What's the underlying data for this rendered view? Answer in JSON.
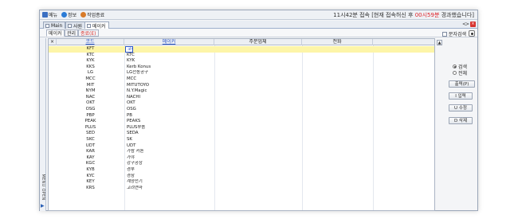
{
  "toolbar": {
    "menu_label": "메뉴",
    "info_label": "정보",
    "end_label": "작업종료",
    "status_prefix": "11시42분 접속 [현재 접속허신 후 ",
    "status_elapsed": "00시59분",
    "status_suffix": " 경과했습니다]"
  },
  "tabs": [
    {
      "label": "Main"
    },
    {
      "label": "사원"
    },
    {
      "label": "메이커"
    }
  ],
  "nav": {
    "prev": "<",
    "next": ">",
    "close": "×"
  },
  "subtabs": [
    {
      "label": "메이커"
    },
    {
      "label": "관리"
    },
    {
      "label": "종료(E)"
    }
  ],
  "search_toggle": "문자검색",
  "grid": {
    "headers": {
      "mark": "×",
      "code": "코드",
      "maker": "메이커",
      "client": "주문업체",
      "phone": "전화"
    },
    "rows": [
      {
        "code": "KFT",
        "name": "코리"
      },
      {
        "code": "KTC",
        "name": "KTC"
      },
      {
        "code": "KYK",
        "name": "KYK"
      },
      {
        "code": "KKS",
        "name": "Kerb Konus"
      },
      {
        "code": "LG",
        "name": "LG전동공구"
      },
      {
        "code": "MCC",
        "name": "MCC"
      },
      {
        "code": "MIT",
        "name": "MITUTOYO"
      },
      {
        "code": "NYM",
        "name": "N.Y.Magic"
      },
      {
        "code": "NAC",
        "name": "NACHI"
      },
      {
        "code": "OKT",
        "name": "OKT"
      },
      {
        "code": "OSG",
        "name": "OSG"
      },
      {
        "code": "PBP",
        "name": "PB"
      },
      {
        "code": "PEAK",
        "name": "PEAKS"
      },
      {
        "code": "PLUS",
        "name": "PLUS부품"
      },
      {
        "code": "SED",
        "name": "SEDA"
      },
      {
        "code": "SKC",
        "name": "SK"
      },
      {
        "code": "UDT",
        "name": "UDT"
      },
      {
        "code": "KAR",
        "name": "가람 커톤"
      },
      {
        "code": "KAY",
        "name": "가야"
      },
      {
        "code": "KGC",
        "name": "강구공장"
      },
      {
        "code": "KYB",
        "name": "경부"
      },
      {
        "code": "KYC",
        "name": "경창"
      },
      {
        "code": "KEY",
        "name": "계양전기"
      },
      {
        "code": "KRS",
        "name": "고려연마"
      }
    ],
    "selected_index": 0
  },
  "right_panel": {
    "scroll_up": "▲",
    "radio_search": "검색",
    "radio_all": "전체",
    "print_btn": "출력(P)",
    "add_btn": "I 입력",
    "edit_btn": "U 수정",
    "delete_btn": "D 삭제"
  },
  "side_menu": {
    "label": "MENU OPEN",
    "arrow": "▶"
  }
}
